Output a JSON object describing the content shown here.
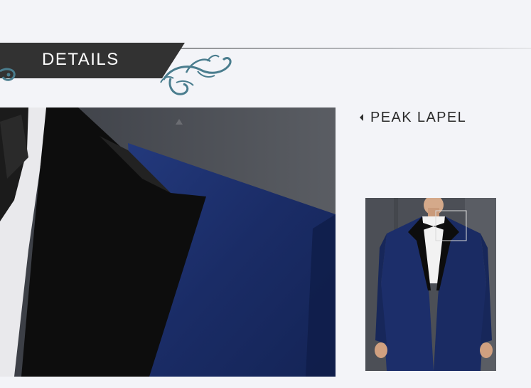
{
  "section": {
    "title": "DETAILS"
  },
  "feature": {
    "label": "PEAK LAPEL",
    "arrow_icon": "caret-left-icon"
  },
  "colors": {
    "banner": "#323232",
    "suit_blue": "#1a2c66",
    "lapel_black": "#0d0d0d",
    "ornament_teal": "#4a7d8e"
  },
  "images": {
    "closeup": "navy-tuxedo-peak-lapel-closeup",
    "thumbnail": "man-in-navy-tuxedo-full-view"
  }
}
